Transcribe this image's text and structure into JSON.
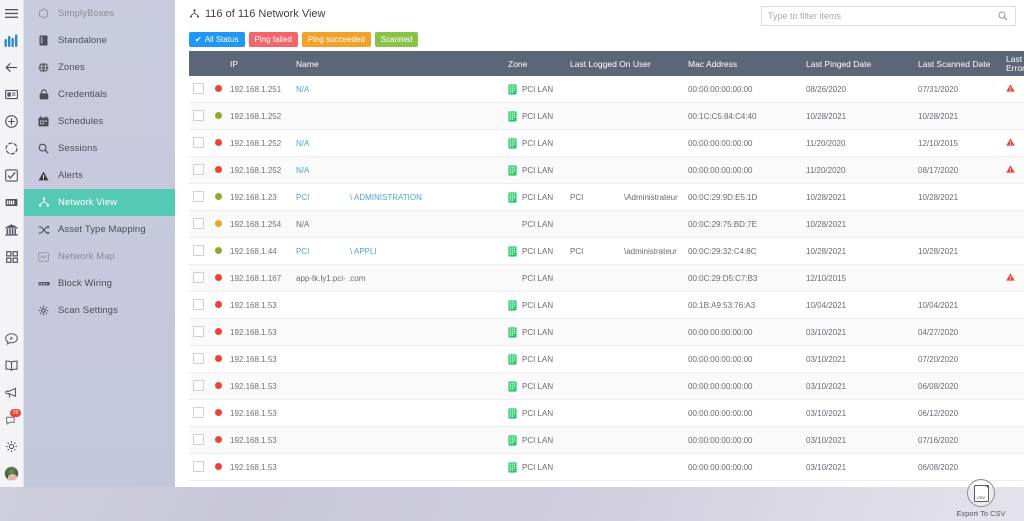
{
  "rail": {
    "icons": [
      {
        "name": "hamburger-menu-icon"
      },
      {
        "name": "brand-logo-icon"
      },
      {
        "name": "back-arrow-icon"
      },
      {
        "name": "ticket-icon"
      },
      {
        "name": "add-circle-icon"
      },
      {
        "name": "refresh-icon"
      },
      {
        "name": "checklist-icon"
      },
      {
        "name": "rack-icon"
      },
      {
        "name": "datacenter-icon"
      },
      {
        "name": "apps-grid-icon"
      }
    ],
    "bottom_icons": [
      {
        "name": "chat-icon"
      },
      {
        "name": "book-icon"
      },
      {
        "name": "megaphone-icon"
      },
      {
        "name": "notifications-icon",
        "badge": "29"
      },
      {
        "name": "gear-icon"
      },
      {
        "name": "avatar"
      }
    ]
  },
  "sidebar": {
    "items": [
      {
        "label": "SimplyBoxes",
        "icon": "box-icon",
        "active": false,
        "dim": true
      },
      {
        "label": "Standalone",
        "icon": "server-icon",
        "active": false,
        "dim": false
      },
      {
        "label": "Zones",
        "icon": "globe-icon",
        "active": false,
        "dim": false
      },
      {
        "label": "Credentials",
        "icon": "lock-icon",
        "active": false,
        "dim": false
      },
      {
        "label": "Schedules",
        "icon": "calendar-icon",
        "active": false,
        "dim": false
      },
      {
        "label": "Sessions",
        "icon": "search-icon",
        "active": false,
        "dim": false
      },
      {
        "label": "Alerts",
        "icon": "warning-icon",
        "active": false,
        "dim": false
      },
      {
        "label": "Network View",
        "icon": "network-icon",
        "active": true,
        "dim": false
      },
      {
        "label": "Asset Type Mapping",
        "icon": "shuffle-icon",
        "active": false,
        "dim": false
      },
      {
        "label": "Network Map",
        "icon": "map-icon",
        "active": false,
        "dim": true
      },
      {
        "label": "Block Wiring",
        "icon": "wiring-icon",
        "active": false,
        "dim": false
      },
      {
        "label": "Scan Settings",
        "icon": "settings-icon",
        "active": false,
        "dim": false
      }
    ]
  },
  "header": {
    "title": "116 of 116 Network View",
    "title_icon": "network-icon"
  },
  "search": {
    "placeholder": "Type to filter items",
    "value": "",
    "icon": "search-icon"
  },
  "filters": [
    {
      "label": "All Status",
      "color": "#2196f3",
      "checked": true
    },
    {
      "label": "Ping failed",
      "color": "#f0666b",
      "checked": false
    },
    {
      "label": "Ping succeeded",
      "color": "#f0a32a",
      "checked": false
    },
    {
      "label": "Scanned",
      "color": "#8bc34a",
      "checked": false
    }
  ],
  "table": {
    "columns": [
      "",
      "",
      "IP",
      "Name",
      "Zone",
      "Last Logged On User",
      "Mac Address",
      "Last Pinged Date",
      "Last Scanned Date",
      "Last Error"
    ],
    "last_error_line1": "Last",
    "last_error_line2": "Error",
    "rows": [
      {
        "status": "red",
        "ip": "192.168.1.251",
        "name_a": "N/A",
        "name_b": "",
        "name_link": true,
        "zone": "PCI LAN",
        "zone_icon": true,
        "user_a": "",
        "user_b": "",
        "mac": "00:00:00:00:00:00",
        "pinged": "08/26/2020",
        "scanned": "07/31/2020",
        "error": true
      },
      {
        "status": "green",
        "ip": "192.168.1.252",
        "name_a": "",
        "name_b": "",
        "name_link": false,
        "zone": "PCI LAN",
        "zone_icon": true,
        "user_a": "",
        "user_b": "",
        "mac": "00:1C:C5:84:C4:40",
        "pinged": "10/28/2021",
        "scanned": "10/28/2021",
        "error": false
      },
      {
        "status": "red",
        "ip": "192.168.1.252",
        "name_a": "N/A",
        "name_b": "",
        "name_link": true,
        "zone": "PCI LAN",
        "zone_icon": true,
        "user_a": "",
        "user_b": "",
        "mac": "00:00:00:00:00:00",
        "pinged": "11/20/2020",
        "scanned": "12/10/2015",
        "error": true
      },
      {
        "status": "red",
        "ip": "192.168.1.252",
        "name_a": "N/A",
        "name_b": "",
        "name_link": true,
        "zone": "PCI LAN",
        "zone_icon": true,
        "user_a": "",
        "user_b": "",
        "mac": "00:00:00:00:00:00",
        "pinged": "11/20/2020",
        "scanned": "08/17/2020",
        "error": true
      },
      {
        "status": "green",
        "ip": "192.168.1.23",
        "name_a": "PCI",
        "name_b": "\\ ADMINISTRATION",
        "name_link": true,
        "zone": "PCI LAN",
        "zone_icon": true,
        "user_a": "PCI",
        "user_b": "\\Administrateur",
        "mac": "00:0C:29:9D:E5:1D",
        "pinged": "10/28/2021",
        "scanned": "10/28/2021",
        "error": false
      },
      {
        "status": "orange",
        "ip": "192.168.1.254",
        "name_a": "N/A",
        "name_b": "",
        "name_link": false,
        "zone": "PCI LAN",
        "zone_icon": false,
        "user_a": "",
        "user_b": "",
        "mac": "00:0C:29:75:BD:7E",
        "pinged": "10/28/2021",
        "scanned": "",
        "error": false
      },
      {
        "status": "green",
        "ip": "192.168.1.44",
        "name_a": "PCI",
        "name_b": "\\ APPLI",
        "name_link": true,
        "zone": "PCI LAN",
        "zone_icon": true,
        "user_a": "PCI",
        "user_b": "\\administrateur",
        "mac": "00:0C:29:32:C4:8C",
        "pinged": "10/28/2021",
        "scanned": "10/28/2021",
        "error": false
      },
      {
        "status": "red",
        "ip": "192.168.1.167",
        "name_a": "app-tk.ly1.pci-        .com",
        "name_b": "",
        "name_link": false,
        "zone": "PCI LAN",
        "zone_icon": false,
        "user_a": "",
        "user_b": "",
        "mac": "00:0C:29:D5:C7:B3",
        "pinged": "12/10/2015",
        "scanned": "",
        "error": true
      },
      {
        "status": "red",
        "ip": "192.168.1.53",
        "name_a": "",
        "name_b": "",
        "name_link": false,
        "zone": "PCI LAN",
        "zone_icon": true,
        "user_a": "",
        "user_b": "",
        "mac": "00:1B:A9:53:76:A3",
        "pinged": "10/04/2021",
        "scanned": "10/04/2021",
        "error": false
      },
      {
        "status": "red",
        "ip": "192.168.1.53",
        "name_a": "",
        "name_b": "",
        "name_link": false,
        "zone": "PCI LAN",
        "zone_icon": true,
        "user_a": "",
        "user_b": "",
        "mac": "00:00:00:00:00:00",
        "pinged": "03/10/2021",
        "scanned": "04/27/2020",
        "error": false
      },
      {
        "status": "red",
        "ip": "192.168.1.53",
        "name_a": "",
        "name_b": "",
        "name_link": false,
        "zone": "PCI LAN",
        "zone_icon": true,
        "user_a": "",
        "user_b": "",
        "mac": "00:00:00:00:00:00",
        "pinged": "03/10/2021",
        "scanned": "07/20/2020",
        "error": false
      },
      {
        "status": "red",
        "ip": "192.168.1.53",
        "name_a": "",
        "name_b": "",
        "name_link": false,
        "zone": "PCI LAN",
        "zone_icon": true,
        "user_a": "",
        "user_b": "",
        "mac": "00:00:00:00:00:00",
        "pinged": "03/10/2021",
        "scanned": "06/08/2020",
        "error": false
      },
      {
        "status": "red",
        "ip": "192.168.1.53",
        "name_a": "",
        "name_b": "",
        "name_link": false,
        "zone": "PCI LAN",
        "zone_icon": true,
        "user_a": "",
        "user_b": "",
        "mac": "00:00:00:00:00:00",
        "pinged": "03/10/2021",
        "scanned": "06/12/2020",
        "error": false
      },
      {
        "status": "red",
        "ip": "192.168.1.53",
        "name_a": "",
        "name_b": "",
        "name_link": false,
        "zone": "PCI LAN",
        "zone_icon": true,
        "user_a": "",
        "user_b": "",
        "mac": "00:00:00:00:00:00",
        "pinged": "03/10/2021",
        "scanned": "07/16/2020",
        "error": false
      },
      {
        "status": "red",
        "ip": "192.168.1.53",
        "name_a": "",
        "name_b": "",
        "name_link": false,
        "zone": "PCI LAN",
        "zone_icon": true,
        "user_a": "",
        "user_b": "",
        "mac": "00:00:00:00:00:00",
        "pinged": "03/10/2021",
        "scanned": "06/08/2020",
        "error": false
      }
    ]
  },
  "export": {
    "label": "Export To CSV",
    "icon": "csv-file-icon",
    "doc_text": "CSV"
  },
  "colors": {
    "accent_teal": "#55c9b4",
    "header_slate": "#5c6676",
    "status_red": "#ef4136",
    "status_green": "#8aad2f",
    "status_orange": "#f0a32a",
    "link_blue": "#4aa3df"
  }
}
